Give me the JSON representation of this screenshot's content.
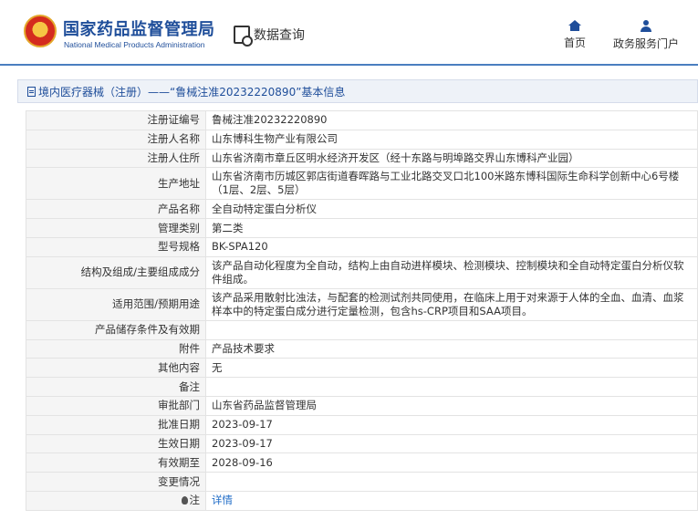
{
  "header": {
    "site_title_cn": "国家药品监督管理局",
    "site_title_en": "National Medical Products Administration",
    "data_query": "数据查询",
    "nav": [
      {
        "label": "首页",
        "icon": "home-icon"
      },
      {
        "label": "政务服务门户",
        "icon": "user-icon"
      }
    ],
    "colors": {
      "brand": "#1f4e9a",
      "accent": "#4a7ec0"
    }
  },
  "breadcrumb": "境内医疗器械（注册）——“鲁械注准20232220890”基本信息",
  "fields": [
    {
      "key": "注册证编号",
      "value": "鲁械注准20232220890"
    },
    {
      "key": "注册人名称",
      "value": "山东博科生物产业有限公司"
    },
    {
      "key": "注册人住所",
      "value": "山东省济南市章丘区明水经济开发区（经十东路与明埠路交界山东博科产业园）"
    },
    {
      "key": "生产地址",
      "value": "山东省济南市历城区郭店街道春晖路与工业北路交叉口北100米路东博科国际生命科学创新中心6号楼（1层、2层、5层）"
    },
    {
      "key": "产品名称",
      "value": "全自动特定蛋白分析仪"
    },
    {
      "key": "管理类别",
      "value": "第二类"
    },
    {
      "key": "型号规格",
      "value": "BK-SPA120"
    },
    {
      "key": "结构及组成/主要组成成分",
      "value": "该产品自动化程度为全自动，结构上由自动进样模块、检测模块、控制模块和全自动特定蛋白分析仪软件组成。"
    },
    {
      "key": "适用范围/预期用途",
      "value": "该产品采用散射比浊法，与配套的检测试剂共同使用，在临床上用于对来源于人体的全血、血清、血浆样本中的特定蛋白成分进行定量检测，包含hs-CRP项目和SAA项目。"
    },
    {
      "key": "产品储存条件及有效期",
      "value": ""
    },
    {
      "key": "附件",
      "value": "产品技术要求"
    },
    {
      "key": "其他内容",
      "value": "无"
    },
    {
      "key": "备注",
      "value": ""
    },
    {
      "key": "审批部门",
      "value": "山东省药品监督管理局"
    },
    {
      "key": "批准日期",
      "value": "2023-09-17"
    },
    {
      "key": "生效日期",
      "value": "2023-09-17"
    },
    {
      "key": "有效期至",
      "value": "2028-09-16"
    },
    {
      "key": "变更情况",
      "value": ""
    }
  ],
  "note_row": {
    "key": "注",
    "link": "详情"
  }
}
